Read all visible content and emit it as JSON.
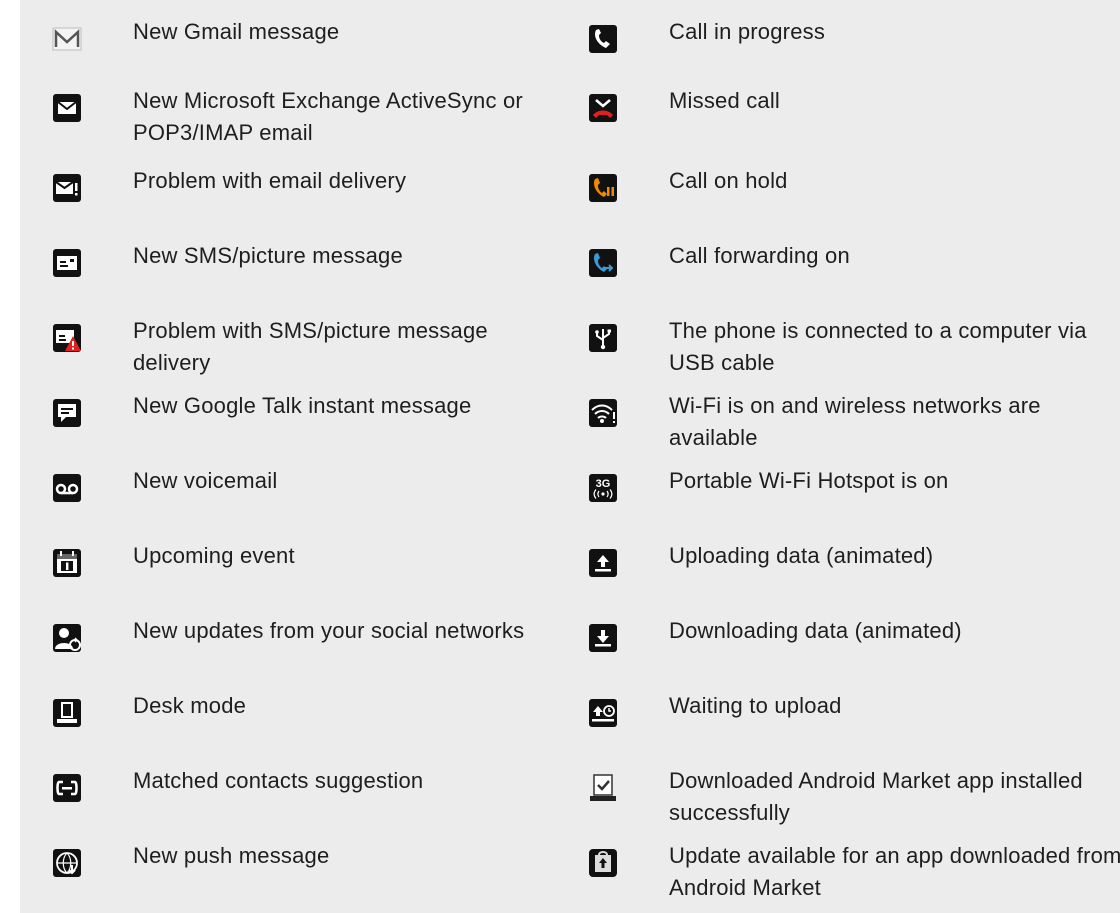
{
  "left_column": [
    {
      "icon": "gmail-icon",
      "label": "New Gmail message"
    },
    {
      "icon": "email-icon",
      "label": "New Microsoft Exchange ActiveSync or POP3/IMAP email"
    },
    {
      "icon": "email-warning-icon",
      "label": "Problem with email delivery"
    },
    {
      "icon": "sms-icon",
      "label": "New SMS/picture message"
    },
    {
      "icon": "sms-warning-icon",
      "label": "Problem with SMS/picture message delivery"
    },
    {
      "icon": "google-talk-icon",
      "label": "New Google Talk instant message"
    },
    {
      "icon": "voicemail-icon",
      "label": "New voicemail"
    },
    {
      "icon": "calendar-icon",
      "label": "Upcoming event"
    },
    {
      "icon": "social-update-icon",
      "label": "New updates from your social networks"
    },
    {
      "icon": "desk-mode-icon",
      "label": "Desk mode"
    },
    {
      "icon": "matched-contacts-icon",
      "label": "Matched contacts suggestion"
    },
    {
      "icon": "push-message-icon",
      "label": "New push message"
    }
  ],
  "right_column": [
    {
      "icon": "call-in-progress-icon",
      "label": "Call in progress"
    },
    {
      "icon": "missed-call-icon",
      "label": "Missed call"
    },
    {
      "icon": "call-on-hold-icon",
      "label": "Call on hold"
    },
    {
      "icon": "call-forwarding-icon",
      "label": "Call forwarding on"
    },
    {
      "icon": "usb-icon",
      "label": "The phone is connected to a computer via USB cable"
    },
    {
      "icon": "wifi-available-icon",
      "label": "Wi-Fi is on and wireless networks are available"
    },
    {
      "icon": "hotspot-icon",
      "label": "Portable Wi-Fi Hotspot is on",
      "icon_text": "3G"
    },
    {
      "icon": "upload-icon",
      "label": "Uploading data (animated)"
    },
    {
      "icon": "download-icon",
      "label": "Downloading data (animated)"
    },
    {
      "icon": "waiting-upload-icon",
      "label": "Waiting to upload"
    },
    {
      "icon": "market-installed-icon",
      "label": "Downloaded Android Market app installed successfully"
    },
    {
      "icon": "market-update-icon",
      "label": "Update available for an app downloaded from Android Market"
    }
  ],
  "colors": {
    "table_bg": "#ececec",
    "icon_bg": "#111111",
    "missed_red": "#e02020",
    "hold_orange": "#f08a00",
    "forward_blue": "#3a9ad9"
  }
}
